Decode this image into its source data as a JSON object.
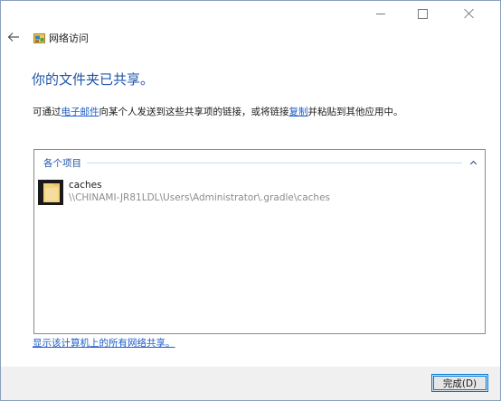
{
  "window": {
    "title": "网络访问"
  },
  "icons": {
    "back": "back-arrow-icon",
    "app": "network-access-icon",
    "minimize": "minimize-icon",
    "maximize": "maximize-icon",
    "close": "close-icon",
    "folder": "folder-icon",
    "collapse": "chevron-up-icon"
  },
  "main": {
    "heading": "你的文件夹已共享。",
    "instructions": {
      "part1": "可通过",
      "link_email": "电子邮件",
      "part2": "向某个人发送到这些共享项的链接，或将链接",
      "link_copy": "复制",
      "part3": "并粘贴到其他应用中。"
    },
    "list": {
      "group_title": "各个项目",
      "items": [
        {
          "name": "caches",
          "path": "\\\\CHINAMI-JR81LDL\\Users\\Administrator\\.gradle\\caches"
        }
      ]
    },
    "footer_link": "显示该计算机上的所有网络共享。"
  },
  "buttons": {
    "done": "完成(D)"
  },
  "colors": {
    "heading_blue": "#1e55a8",
    "link_blue": "#1e5dc8",
    "focus_blue": "#0078d7"
  }
}
